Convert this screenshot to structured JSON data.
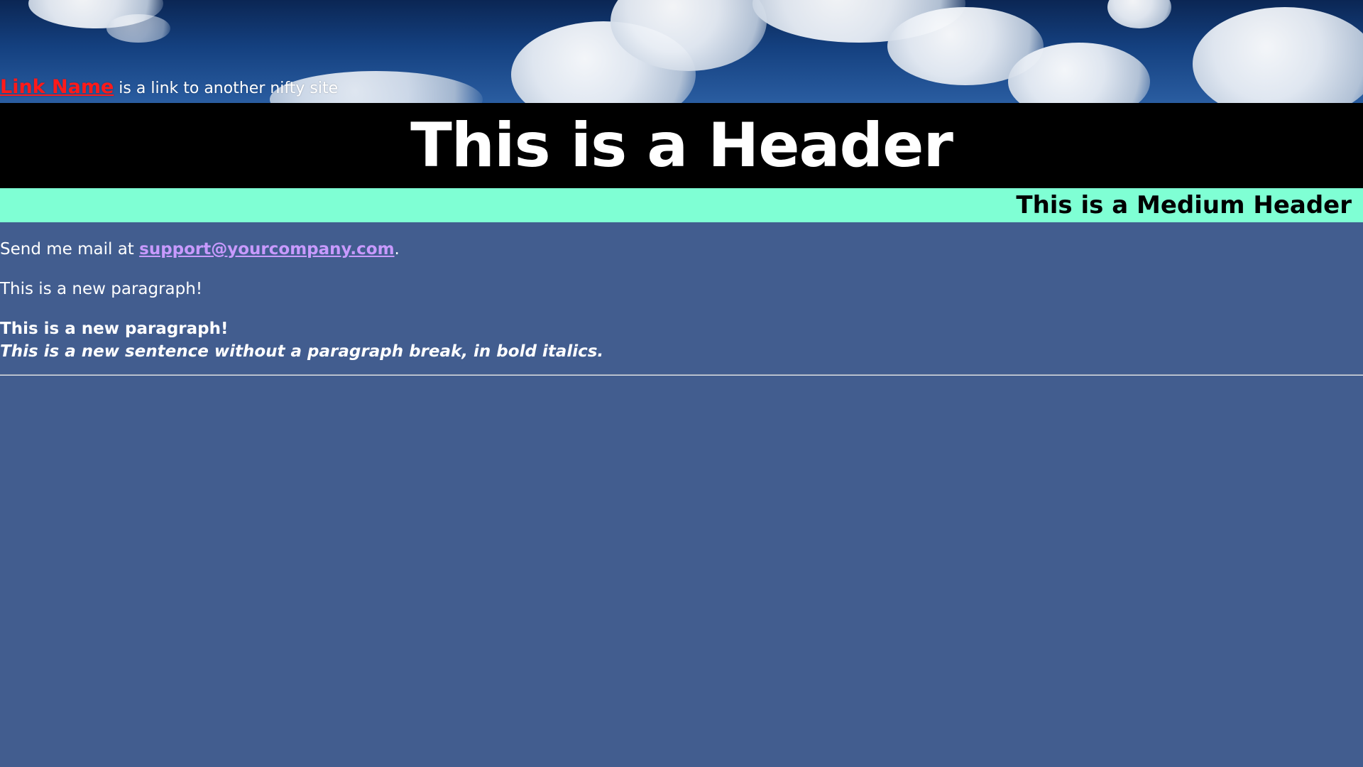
{
  "banner": {
    "link_label": "Link Name",
    "link_suffix": " is a link to another nifty site"
  },
  "header": {
    "title": "This is a Header"
  },
  "medium_header": {
    "title": "This is a Medium Header"
  },
  "content": {
    "mail_prefix": "Send me mail at ",
    "mail_link": "support@yourcompany.com",
    "mail_suffix": ".",
    "paragraph_plain": "This is a new paragraph!",
    "paragraph_bold": "This is a new paragraph!",
    "sentence_bold_italic": "This is a new sentence without a paragraph break, in bold italics."
  },
  "colors": {
    "page_background": "#425d8f",
    "header_background": "#000000",
    "medium_header_background": "#7fffd4",
    "link_color": "#ff1a1a",
    "email_link_color": "#c89aff"
  }
}
